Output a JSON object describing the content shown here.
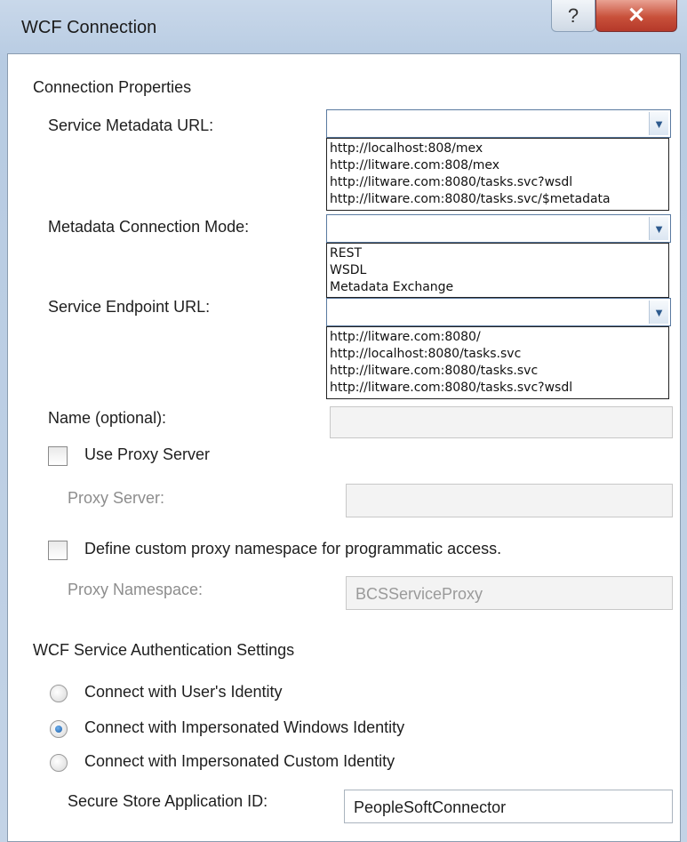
{
  "window": {
    "title": "WCF Connection",
    "help_glyph": "?",
    "close_glyph": "✕"
  },
  "connection": {
    "section_label": "Connection Properties",
    "metadata_url_label": "Service Metadata URL:",
    "metadata_url_value": "",
    "metadata_url_options": [
      "http://localhost:808/mex",
      "http://litware.com:808/mex",
      "http://litware.com:8080/tasks.svc?wsdl",
      "http://litware.com:8080/tasks.svc/$metadata"
    ],
    "mode_label": "Metadata Connection Mode:",
    "mode_value": "",
    "mode_options": [
      "REST",
      "WSDL",
      "Metadata Exchange"
    ],
    "endpoint_label": "Service Endpoint URL:",
    "endpoint_value": "",
    "endpoint_options": [
      "http://litware.com:8080/",
      "http://localhost:8080/tasks.svc",
      "http://litware.com:8080/tasks.svc",
      "http://litware.com:8080/tasks.svc?wsdl"
    ],
    "name_label": "Name (optional):",
    "name_value": "",
    "use_proxy_label": "Use Proxy Server",
    "use_proxy_checked": false,
    "proxy_server_label": "Proxy Server:",
    "proxy_server_value": "",
    "custom_ns_label": "Define custom proxy namespace for programmatic access.",
    "custom_ns_checked": false,
    "proxy_ns_label": "Proxy Namespace:",
    "proxy_ns_value": "BCSServiceProxy"
  },
  "auth": {
    "section_label": "WCF Service Authentication Settings",
    "options": [
      {
        "label": "Connect with User's Identity",
        "selected": false
      },
      {
        "label": "Connect with Impersonated Windows Identity",
        "selected": true
      },
      {
        "label": "Connect with Impersonated Custom Identity",
        "selected": false
      }
    ],
    "secure_store_label": "Secure Store Application ID:",
    "secure_store_value": "PeopleSoftConnector"
  },
  "colors": {
    "close_button": "#c8503a",
    "focus_border": "#5a7aa0",
    "selected_radio": "#1d5fa8"
  },
  "icons": {
    "dropdown_arrow": "chevron-down-icon"
  }
}
